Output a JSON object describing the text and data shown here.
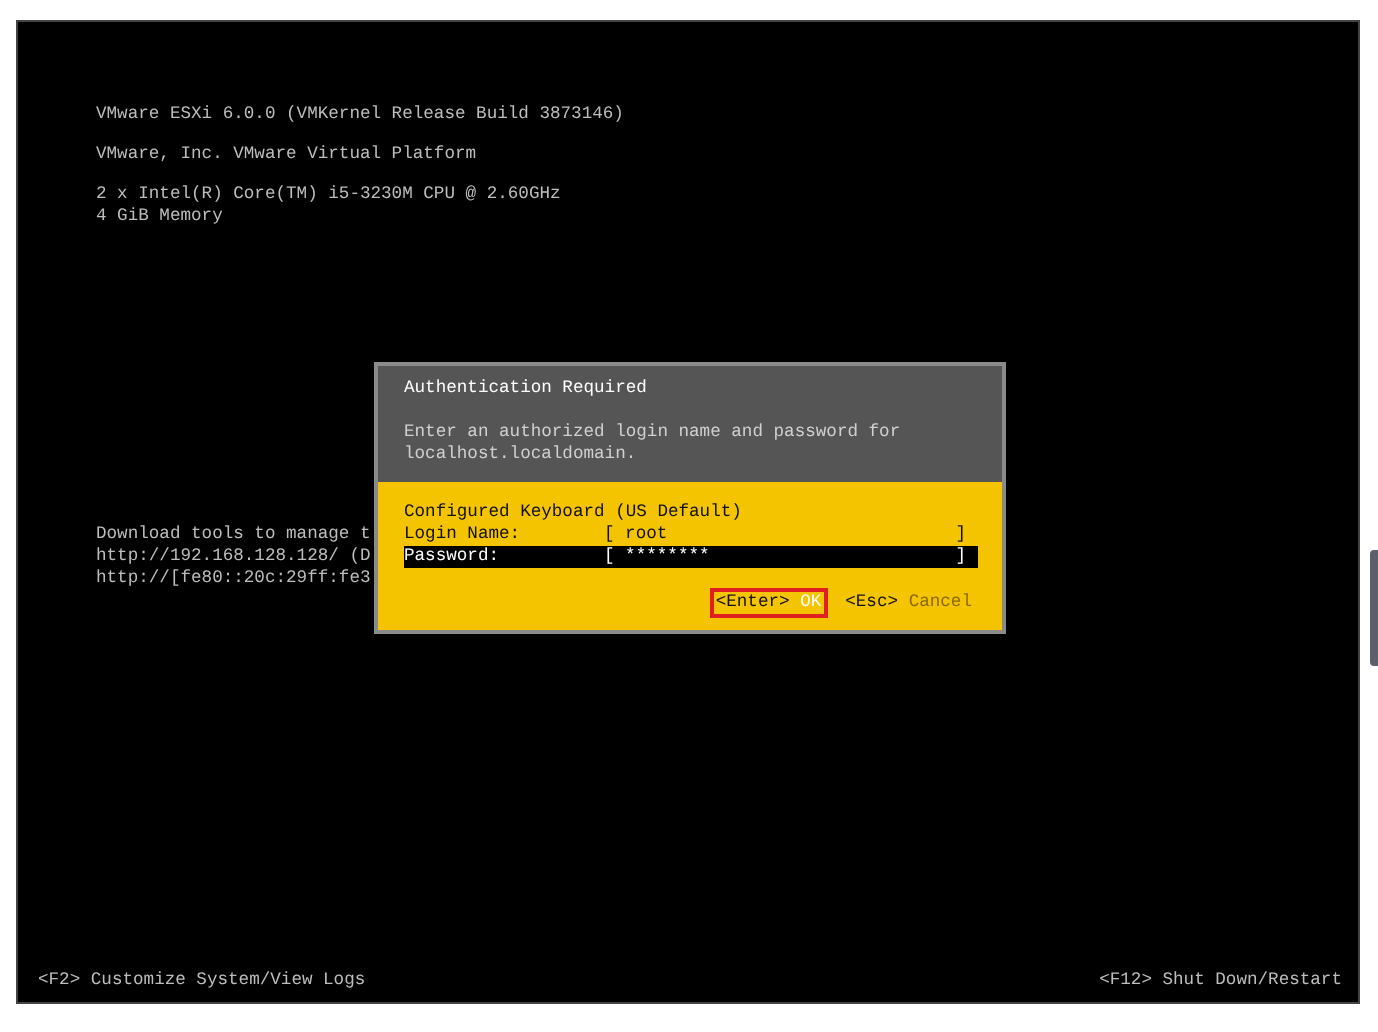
{
  "system_info": [
    "VMware ESXi 6.0.0 (VMKernel Release Build 3873146)",
    "VMware, Inc. VMware Virtual Platform"
  ],
  "hardware": [
    "2 x Intel(R) Core(TM) i5-3230M CPU @ 2.60GHz",
    "4 GiB Memory"
  ],
  "management": [
    "Download tools to manage t",
    "http://192.168.128.128/ (D",
    "http://[fe80::20c:29ff:fe3"
  ],
  "dialog": {
    "title": "Authentication Required",
    "description": "Enter an authorized login name and password for localhost.localdomain.",
    "keyboard": "Configured Keyboard (US Default)",
    "fields": [
      {
        "label": "Login Name:",
        "open": "[",
        "value": "root",
        "close": "]",
        "selected": false
      },
      {
        "label": "Password:",
        "open": "[",
        "value": "********",
        "close": "]",
        "selected": true
      }
    ],
    "buttons": [
      {
        "key": "<Enter>",
        "label": "OK",
        "highlighted": true
      },
      {
        "key": "<Esc>",
        "label": "Cancel",
        "highlighted": false
      }
    ]
  },
  "footer": {
    "left": "<F2> Customize System/View Logs",
    "right": "<F12> Shut Down/Restart"
  }
}
